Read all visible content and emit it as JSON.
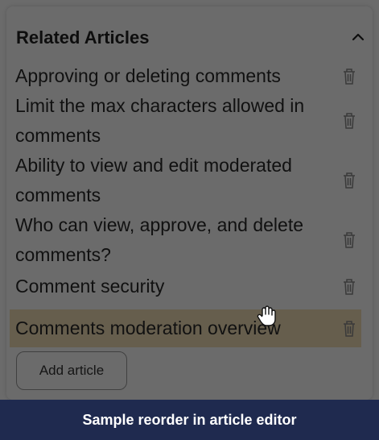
{
  "panel": {
    "title": "Related Articles",
    "collapse_icon": "chevron-up-icon",
    "articles": [
      {
        "title": "Approving or deleting comments"
      },
      {
        "title": "Limit the max characters allowed in comments"
      },
      {
        "title": "Ability to view and edit moderated comments"
      },
      {
        "title": "Who can view, approve, and delete comments?"
      },
      {
        "title": "Comment security"
      },
      {
        "title": "Comments moderation overview",
        "state": "dragging"
      }
    ],
    "delete_icon": "trash-icon",
    "add_button_label": "Add article"
  },
  "cursor_icon": "grab-hand-icon",
  "caption": "Sample reorder in article editor",
  "colors": {
    "overlay": "#000000",
    "drag_highlight": "#f2dfb8",
    "caption_bg": "#1f2a4f"
  }
}
